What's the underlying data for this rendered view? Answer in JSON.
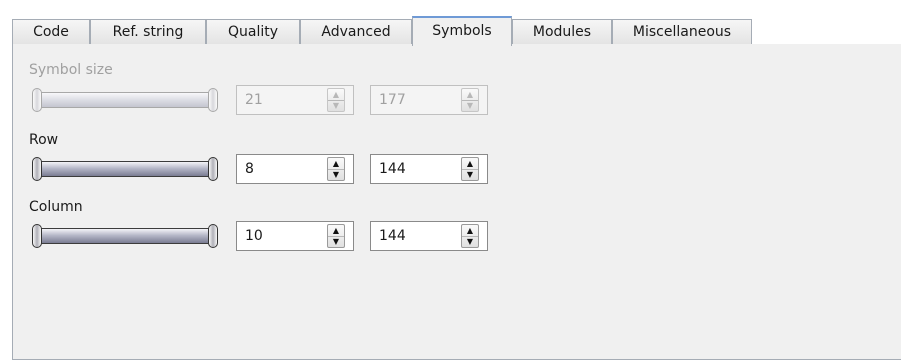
{
  "tabs": [
    "Code",
    "Ref. string",
    "Quality",
    "Advanced",
    "Symbols",
    "Modules",
    "Miscellaneous"
  ],
  "active_tab": "Symbols",
  "groups": [
    {
      "label": "Symbol size",
      "enabled": false,
      "min_value": "21",
      "max_value": "177"
    },
    {
      "label": "Row",
      "enabled": true,
      "min_value": "8",
      "max_value": "144"
    },
    {
      "label": "Column",
      "enabled": true,
      "min_value": "10",
      "max_value": "144"
    }
  ],
  "icons": {
    "spin_up": "spin-up-arrow",
    "spin_down": "spin-down-arrow"
  },
  "colors": {
    "active_tab_accent": "#6f9ad6",
    "panel_bg": "#f0f0f0",
    "disabled_text": "#a0a0a0"
  }
}
